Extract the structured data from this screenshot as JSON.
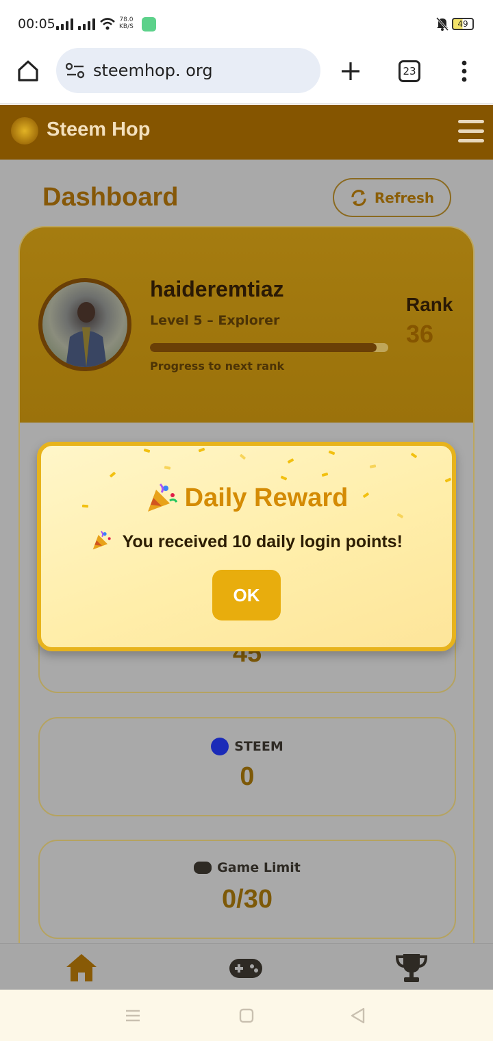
{
  "status_bar": {
    "time": "00:05",
    "network_speed": "78.0",
    "network_unit": "KB/S",
    "battery": "49"
  },
  "browser": {
    "url": "steemhop. org",
    "tab_count": "23"
  },
  "app": {
    "title": "Steem Hop",
    "logo_text": "STEEM HOP",
    "brand_color": "#855500"
  },
  "dashboard": {
    "title": "Dashboard",
    "refresh_label": "Refresh"
  },
  "profile": {
    "username": "haideremtiaz",
    "level": "Level 5 – Explorer",
    "progress_fraction": 0.95,
    "progress_label": "Progress to next rank",
    "rank_label": "Rank",
    "rank_value": "36"
  },
  "stats": [
    {
      "label": "",
      "value": "45"
    },
    {
      "label": "STEEM",
      "value": "0",
      "icon": "steem-icon"
    },
    {
      "label": "Game Limit",
      "value": "0/30",
      "icon": "gamepad-icon"
    }
  ],
  "modal": {
    "title": "Daily Reward",
    "message": "You received 10 daily login points!",
    "ok_label": "OK",
    "icon": "party-popper-icon"
  },
  "bottom_nav": {
    "items": [
      "home-icon",
      "gamepad-icon",
      "trophy-icon"
    ]
  }
}
